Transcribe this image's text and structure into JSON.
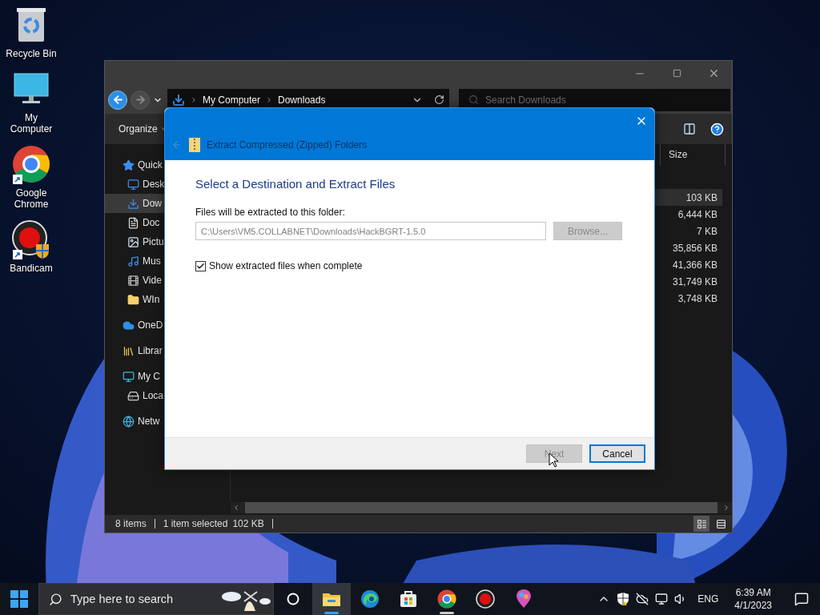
{
  "desktop_icons": [
    {
      "kind": "recycle",
      "label": "Recycle Bin",
      "shortcut": false
    },
    {
      "kind": "computer",
      "label": "My Computer",
      "shortcut": false
    },
    {
      "kind": "chrome",
      "label": "Google Chrome",
      "shortcut": true
    },
    {
      "kind": "bandicam",
      "label": "Bandicam",
      "shortcut": true
    }
  ],
  "explorer": {
    "address": [
      "My Computer",
      "Downloads"
    ],
    "search": {
      "placeholder": "Search Downloads"
    },
    "toolbar": {
      "organize": "Organize"
    },
    "nav_pane": [
      {
        "kind": "star",
        "label": "Quick",
        "selected": false,
        "children": [
          {
            "kind": "desktop",
            "label": "Desk",
            "selected": false
          },
          {
            "kind": "download",
            "label": "Dow",
            "selected": true
          },
          {
            "kind": "document",
            "label": "Doc",
            "selected": false
          },
          {
            "kind": "pictures",
            "label": "Pictu",
            "selected": false
          },
          {
            "kind": "music",
            "label": "Mus",
            "selected": false
          },
          {
            "kind": "video",
            "label": "Vide",
            "selected": false
          },
          {
            "kind": "folder",
            "label": "WIn",
            "selected": false
          }
        ]
      },
      {
        "kind": "cloud",
        "label": "OneD",
        "selected": false
      },
      {
        "kind": "library",
        "label": "Librar",
        "selected": false
      },
      {
        "kind": "computer",
        "label": "My C",
        "selected": false,
        "children": [
          {
            "kind": "drive",
            "label": "Loca",
            "selected": false
          }
        ]
      },
      {
        "kind": "network",
        "label": "Netw",
        "selected": false
      }
    ],
    "columns": [
      "Size"
    ],
    "rows": [
      {
        "size": "103 KB",
        "selected": true
      },
      {
        "size": "6,444 KB",
        "selected": false
      },
      {
        "size": "7 KB",
        "selected": false
      },
      {
        "size": "35,856 KB",
        "selected": false
      },
      {
        "size": "41,366 KB",
        "selected": false
      },
      {
        "size": "31,749 KB",
        "selected": false
      },
      {
        "size": "3,748 KB",
        "selected": false
      }
    ],
    "status_bar": {
      "items": "8 items",
      "selection": "1 item selected",
      "size": "102 KB"
    }
  },
  "dialog": {
    "title": "Extract Compressed (Zipped) Folders",
    "heading": "Select a Destination and Extract Files",
    "field_label": "Files will be extracted to this folder:",
    "path": {
      "value": "C:\\Users\\VM5.COLLABNET\\Downloads\\HackBGRT-1.5.0",
      "disabled": true
    },
    "browse": {
      "label": "Browse...",
      "disabled": true
    },
    "show_files": {
      "label": "Show extracted files when complete",
      "checked": true
    },
    "buttons": [
      {
        "label": "Next",
        "disabled": true,
        "focused": false
      },
      {
        "label": "Cancel",
        "disabled": false,
        "focused": true
      }
    ]
  },
  "taskbar": {
    "search": {
      "placeholder": "Type here to search"
    },
    "apps": [
      {
        "kind": "explorer",
        "selected": true,
        "running": true
      },
      {
        "kind": "edge",
        "selected": false,
        "running": false
      },
      {
        "kind": "store",
        "selected": false,
        "running": false
      },
      {
        "kind": "chrome",
        "selected": false,
        "running": true
      },
      {
        "kind": "bandicam",
        "selected": false,
        "running": false
      },
      {
        "kind": "paint",
        "selected": false,
        "running": false
      }
    ],
    "language": "ENG",
    "time": "6:39 AM",
    "date": "4/1/2023"
  }
}
